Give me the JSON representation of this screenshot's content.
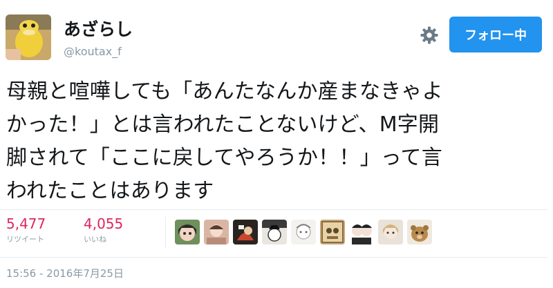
{
  "user": {
    "display_name": "あざらし",
    "handle": "@koutax_f"
  },
  "actions": {
    "settings_icon": "gear-icon",
    "follow_label": "フォロー中",
    "follow_color": "#2293ee"
  },
  "tweet": {
    "text": "母親と喧嘩しても「あんたなんか産まなきゃよ\nかった！」とは言われたことないけど、M字開\n脚されて「ここに戻してやろうか！！」って言\nわれたことはあります"
  },
  "stats": {
    "retweets": {
      "count": "5,477",
      "label": "リツイート"
    },
    "likes": {
      "count": "4,055",
      "label": "いいね"
    },
    "count_color": "#e0245e"
  },
  "timestamp": "15:56 - 2016年7月25日"
}
